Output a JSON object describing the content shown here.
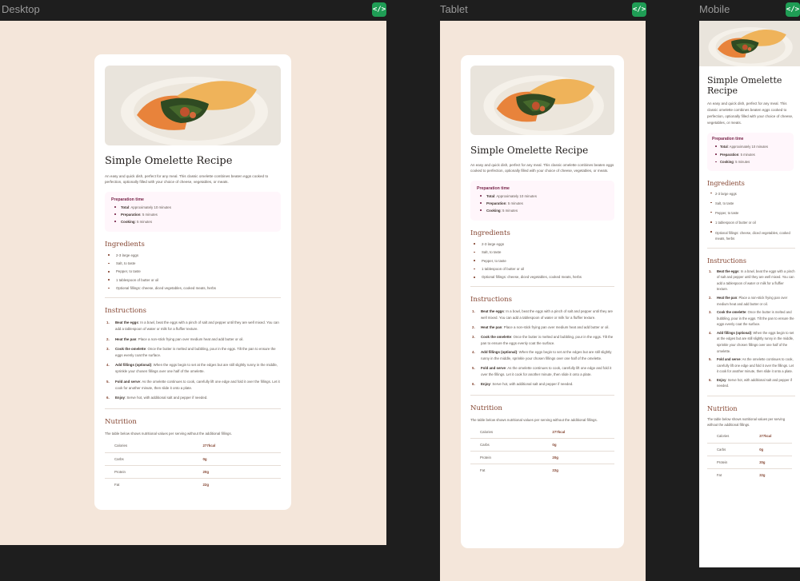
{
  "frames": {
    "desktop": "Desktop",
    "tablet": "Tablet",
    "mobile": "Mobile",
    "code_button": "</>"
  },
  "colors": {
    "canvas": "#1e1e1e",
    "page_background": "#f4e6da",
    "card": "#ffffff",
    "accent_brown": "#854632",
    "accent_rose": "#7b284d",
    "prep_background": "#fff6fb",
    "code_button": "#1f9d55"
  },
  "hero_image": {
    "alt": "omelette-icon"
  },
  "recipe": {
    "title": "Simple Omelette Recipe",
    "intro": "An easy and quick dish, perfect for any meal. This classic omelette combines beaten eggs cooked to perfection, optionally filled with your choice of cheese, vegetables, or meats.",
    "prep": {
      "title": "Preparation time",
      "items": [
        {
          "label": "Total",
          "value": ": Approximately 10 minutes"
        },
        {
          "label": "Preparation",
          "value": ": 5 minutes"
        },
        {
          "label": "Cooking",
          "value": ": 5 minutes"
        }
      ]
    },
    "ingredients": {
      "title": "Ingredients",
      "items": [
        "2-3 large eggs",
        "Salt, to taste",
        "Pepper, to taste",
        "1 tablespoon of butter or oil",
        "Optional fillings: cheese, diced vegetables, cooked meats, herbs"
      ]
    },
    "instructions": {
      "title": "Instructions",
      "steps": [
        {
          "label": "Beat the eggs",
          "text": ": In a bowl, beat the eggs with a pinch of salt and pepper until they are well mixed. You can add a tablespoon of water or milk for a fluffier texture."
        },
        {
          "label": "Heat the pan",
          "text": ": Place a non-stick frying pan over medium heat and add butter or oil."
        },
        {
          "label": "Cook the omelette",
          "text": ": Once the butter is melted and bubbling, pour in the eggs. Tilt the pan to ensure the eggs evenly coat the surface."
        },
        {
          "label": "Add fillings (optional)",
          "text": ": When the eggs begin to set at the edges but are still slightly runny in the middle, sprinkle your chosen fillings over one half of the omelette."
        },
        {
          "label": "Fold and serve",
          "text": ": As the omelette continues to cook, carefully lift one edge and fold it over the fillings. Let it cook for another minute, then slide it onto a plate."
        },
        {
          "label": "Enjoy",
          "text": ": Serve hot, with additional salt and pepper if needed."
        }
      ]
    },
    "nutrition": {
      "title": "Nutrition",
      "intro": "The table below shows nutritional values per serving without the additional fillings.",
      "rows": [
        {
          "name": "Calories",
          "value": "277kcal"
        },
        {
          "name": "Carbs",
          "value": "0g"
        },
        {
          "name": "Protein",
          "value": "20g"
        },
        {
          "name": "Fat",
          "value": "22g"
        }
      ]
    }
  }
}
